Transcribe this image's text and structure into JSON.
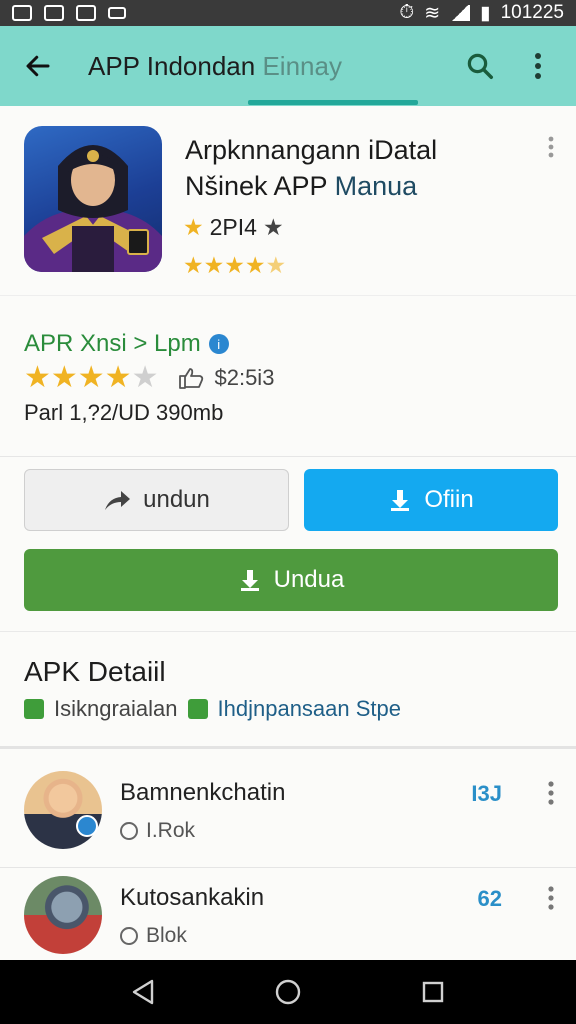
{
  "status_bar": {
    "time": "101225"
  },
  "toolbar": {
    "title_main": "APP Indondan ",
    "title_muted": "Einnay"
  },
  "app": {
    "name_line1": "Arpknnangann iDatal",
    "name_line2_a": "Nšinek APP ",
    "name_line2_b": "Manua",
    "rating_text": "2PI4",
    "stars": 5
  },
  "developer": {
    "line": "APR  Xnsi > Lpm",
    "rating_stars": 4.5,
    "review_count": "$2:5i3",
    "size_line": "Parl 1,?2/UD  390mb"
  },
  "buttons": {
    "gray_label": "undun",
    "blue_label": "Ofiin",
    "green_label": "Undua"
  },
  "detail": {
    "heading": "APK Detaiil",
    "tag1": "Isikngraialan",
    "tag2": "Ihdjnpansaan Stpe"
  },
  "list": [
    {
      "name": "Bamnenkchatin",
      "sub": "I.Rok",
      "value": "I3J"
    },
    {
      "name": "Kutosankakin",
      "sub": "Blok",
      "value": "62"
    }
  ],
  "colors": {
    "toolbar": "#7fd8cb",
    "accent_blue": "#14a9f0",
    "accent_green": "#4f9a3e"
  }
}
